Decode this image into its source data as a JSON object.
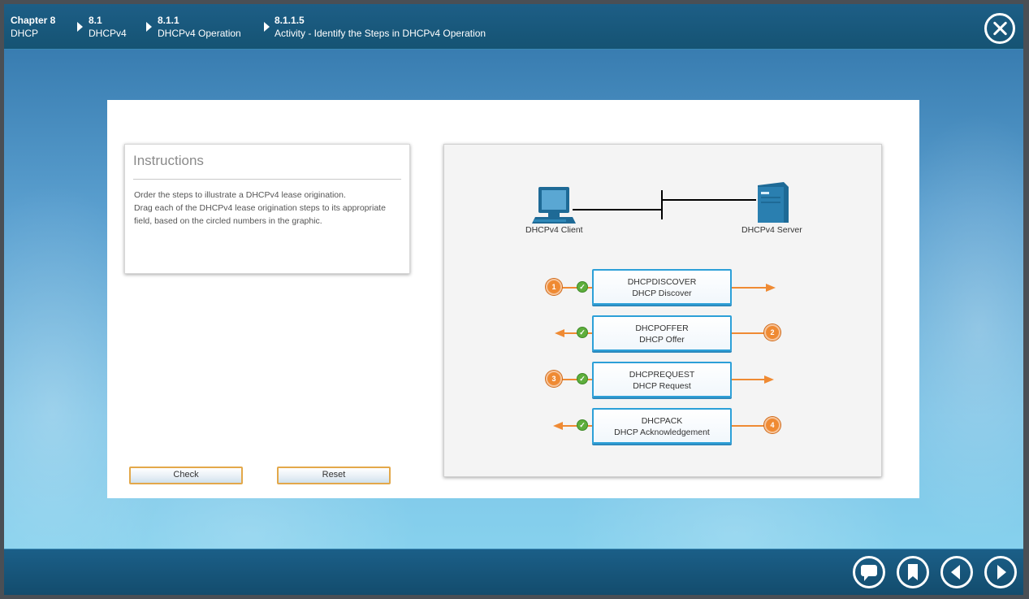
{
  "breadcrumb": [
    {
      "num": "Chapter 8",
      "text": "DHCP"
    },
    {
      "num": "8.1",
      "text": "DHCPv4"
    },
    {
      "num": "8.1.1",
      "text": "DHCPv4 Operation"
    },
    {
      "num": "8.1.1.5",
      "text": "Activity - Identify the Steps in DHCPv4 Operation"
    }
  ],
  "instructions": {
    "title": "Instructions",
    "line1": "Order the steps to illustrate a DHCPv4 lease origination.",
    "line2": "Drag each of the DHCPv4 lease origination steps to its appropriate field, based on the circled numbers in the graphic."
  },
  "buttons": {
    "check": "Check",
    "reset": "Reset"
  },
  "diagram": {
    "client_label": "DHCPv4 Client",
    "server_label": "DHCPv4 Server",
    "steps": [
      {
        "num": "1",
        "line1": "DHCPDISCOVER",
        "line2": "DHCP Discover",
        "direction": "to-server"
      },
      {
        "num": "2",
        "line1": "DHCPOFFER",
        "line2": "DHCP Offer",
        "direction": "to-client"
      },
      {
        "num": "3",
        "line1": "DHCPREQUEST",
        "line2": "DHCP Request",
        "direction": "to-server"
      },
      {
        "num": "4",
        "line1": "DHCPACK",
        "line2": "DHCP Acknowledgement",
        "direction": "to-client"
      }
    ]
  },
  "colors": {
    "accent_orange": "#ef8a33",
    "box_border": "#2da0d8",
    "check_green": "#5eae3c",
    "bar_blue": "#155373"
  },
  "nav_icons": [
    "comment-icon",
    "bookmark-icon",
    "previous-icon",
    "next-icon"
  ]
}
